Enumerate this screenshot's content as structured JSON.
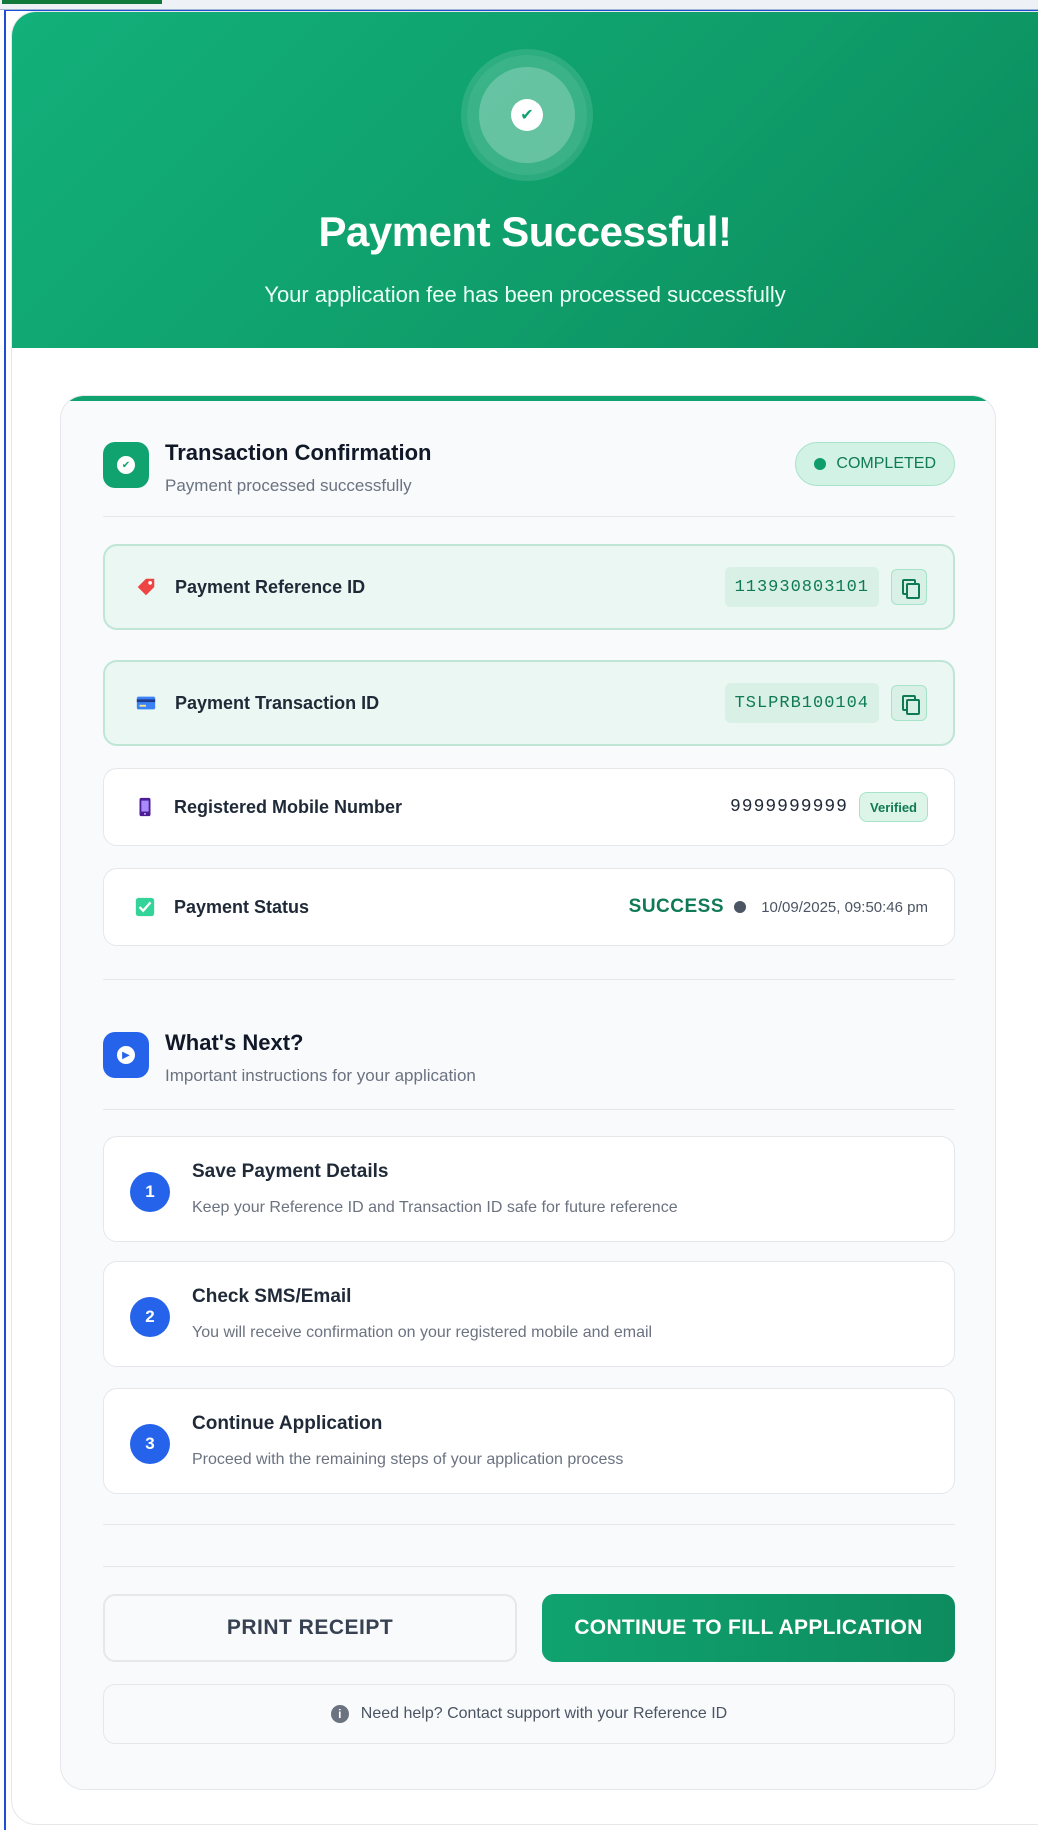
{
  "hero": {
    "title": "Payment Successful!",
    "subtitle": "Your application fee has been processed successfully",
    "check_icon": "check-icon"
  },
  "transaction": {
    "title": "Transaction Confirmation",
    "subtitle": "Payment processed successfully",
    "status_badge": "COMPLETED",
    "rows": {
      "reference": {
        "label": "Payment Reference ID",
        "value": "113930803101",
        "icon": "tag-icon"
      },
      "transaction": {
        "label": "Payment Transaction ID",
        "value": "TSLPRB100104",
        "icon": "credit-card-icon"
      },
      "mobile": {
        "label": "Registered Mobile Number",
        "value": "9999999999",
        "badge": "Verified",
        "icon": "mobile-phone-icon"
      },
      "status": {
        "label": "Payment Status",
        "value": "SUCCESS",
        "timestamp": "10/09/2025, 09:50:46 pm",
        "icon": "checkbox-icon"
      }
    }
  },
  "next": {
    "title": "What's Next?",
    "subtitle": "Important instructions for your application",
    "steps": [
      {
        "num": "1",
        "title": "Save Payment Details",
        "desc": "Keep your Reference ID and Transaction ID safe for future reference"
      },
      {
        "num": "2",
        "title": "Check SMS/Email",
        "desc": "You will receive confirmation on your registered mobile and email"
      },
      {
        "num": "3",
        "title": "Continue Application",
        "desc": "Proceed with the remaining steps of your application process"
      }
    ]
  },
  "actions": {
    "print_label": "PRINT RECEIPT",
    "continue_label": "CONTINUE TO FILL APPLICATION"
  },
  "help": {
    "text": "Need help? Contact support with your Reference ID"
  },
  "colors": {
    "brand_green": "#10a36f",
    "step_blue": "#2563eb"
  }
}
